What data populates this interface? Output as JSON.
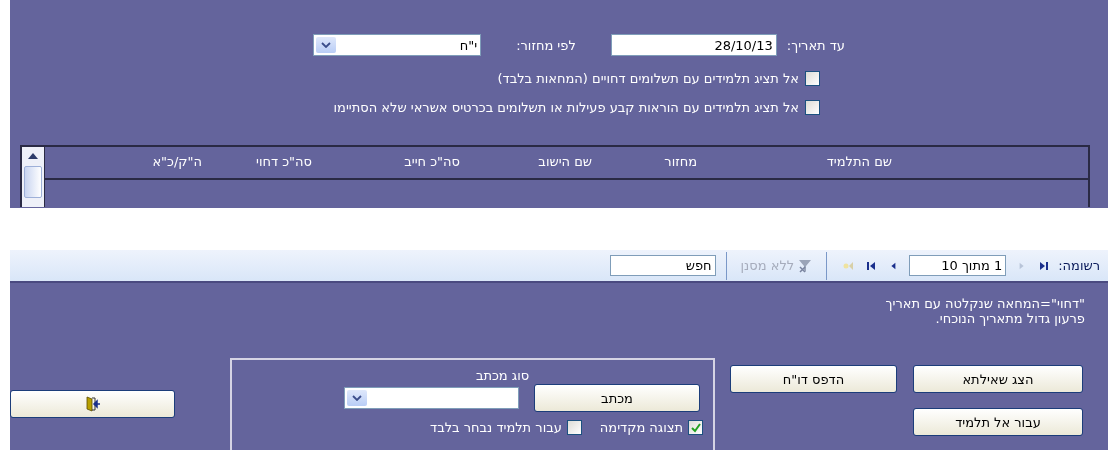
{
  "filters": {
    "date_label": "עד תאריך:",
    "date_value": "28/10/13",
    "cycle_label": "לפי מחזור:",
    "cycle_value": "י\"ח"
  },
  "options": [
    {
      "label": "אל תציג תלמידים עם תשלומים דחויים (המחאות בלבד)",
      "checked": false
    },
    {
      "label": "אל תציג תלמידים עם הוראות קבע פעילות או תשלומים בכרטיס אשראי שלא הסתיימו",
      "checked": false
    }
  ],
  "grid": {
    "columns": [
      "שם התלמיד",
      "מחזור",
      "שם הישוב",
      "סה\"כ חייב",
      "סה\"כ דחוי",
      "ה\"ק/כ\"א"
    ]
  },
  "navigation": {
    "record_label": "רשומה:",
    "position": "1 מתוך 10",
    "filter_status": "ללא מסנן",
    "filter_active": false,
    "search_placeholder": "חפש"
  },
  "note": [
    "\"דחוי\"=המחאה שנקלטה עם תאריך",
    "פרעון גדול מתאריך הנוכחי."
  ],
  "buttons": {
    "show_query": "הצג שאילתא",
    "go_to_student": "עבור אל תלמיד",
    "print_report": "הדפס דו\"ח"
  },
  "letter_group": {
    "title": "סוג מכתב",
    "button": "מכתב",
    "options": [
      {
        "label": "תצוגה מקדימה",
        "checked": true
      },
      {
        "label": "עבור תלמיד נבחר בלבד",
        "checked": false
      }
    ]
  }
}
